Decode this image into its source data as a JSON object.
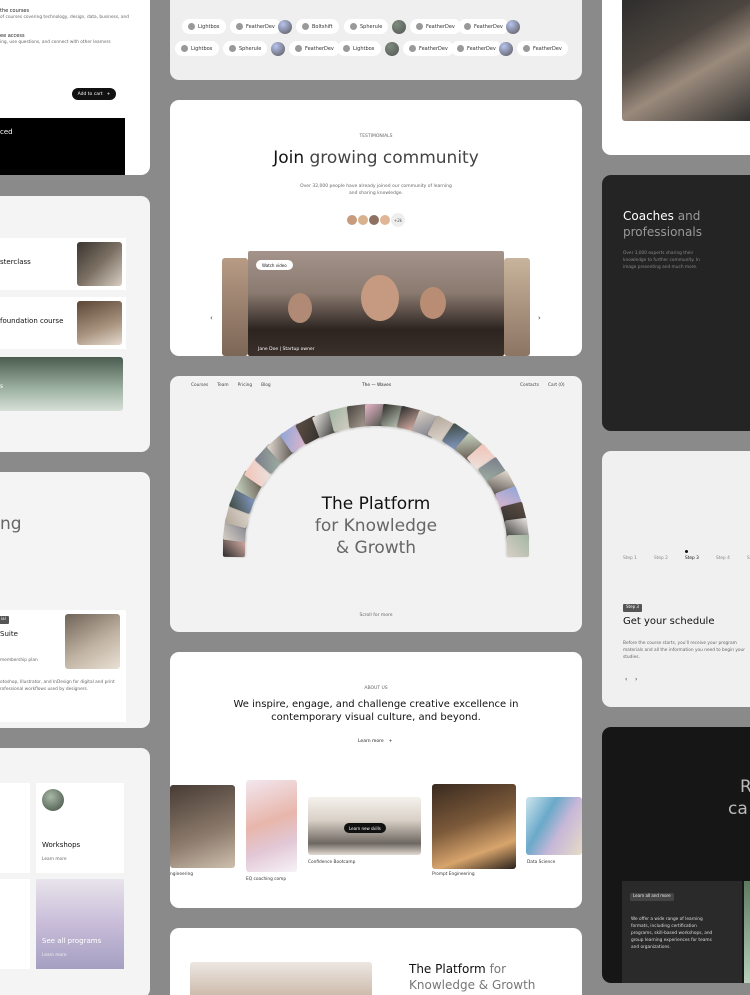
{
  "colors": {
    "page_bg": "#8a8a8a",
    "card_light": "#f4f4f4",
    "card_dark": "#1f1f1f"
  },
  "left": {
    "card1": {
      "line1": "the courses",
      "line2": "of courses covering technology, design, data, business, and",
      "line3": "ee access",
      "line4": "ing, use questions, and connect with other learners",
      "add_to_cart": "Add to cart",
      "add_to_cart_icon": "+",
      "dark_title": "ced"
    },
    "card2": {
      "item1": "sterclass",
      "item2": "foundation course",
      "banner_label": "s"
    },
    "card3": {
      "heading": "ng",
      "tag": "ial",
      "suite": "Suite",
      "plan": "membership plan",
      "desc1": "otoshop, Illustrator, and InDesign for digital and print",
      "desc2": "rofessional workflows used by designers."
    },
    "card4": {
      "workshops": "Workshops",
      "learn_more": "Learn more",
      "see_all": "See all programs",
      "see_all_sub": "Learn more"
    }
  },
  "center": {
    "logos_row1": [
      {
        "name": "Lightbox",
        "icon": "circle-logo-icon"
      },
      {
        "name": "FeatherDev",
        "icon": "feather-logo-icon"
      },
      {
        "name": "Boltshift",
        "icon": "bolt-logo-icon"
      },
      {
        "name": "Spherule",
        "icon": "sphere-logo-icon"
      },
      {
        "name": "FeatherDev",
        "icon": "feather-logo-icon"
      },
      {
        "name": "FeatherDev",
        "icon": "feather-logo-icon"
      }
    ],
    "logos_row2": [
      {
        "name": "Lightbox",
        "icon": "circle-logo-icon"
      },
      {
        "name": "Spherule",
        "icon": "sphere-logo-icon"
      },
      {
        "name": "FeatherDev",
        "icon": "feather-logo-icon"
      },
      {
        "name": "Lightbox",
        "icon": "circle-logo-icon"
      },
      {
        "name": "FeatherDev",
        "icon": "feather-logo-icon"
      },
      {
        "name": "FeatherDev",
        "icon": "feather-logo-icon"
      },
      {
        "name": "FeatherDev",
        "icon": "feather-logo-icon"
      }
    ],
    "testimonials": {
      "eyebrow": "TESTIMONIALS",
      "title_a": "Join",
      "title_b": "growing community",
      "sub1": "Over 32,000 people have already joined our community of learning",
      "sub2": "and sharing knowledge.",
      "count_badge": "+2k",
      "watch": "Watch video",
      "person": "Jane Doe",
      "role": "Startup owner",
      "prev": "‹",
      "next": "›"
    },
    "hero": {
      "nav": [
        "Courses",
        "Team",
        "Pricing",
        "Blog"
      ],
      "brand": "The — Waves",
      "nav_right": [
        "Contacts",
        "Cart (0)"
      ],
      "title1": "The Platform",
      "title2": "for Knowledge",
      "title3": "& Growth",
      "scroll": "Scroll for more"
    },
    "about": {
      "eyebrow": "ABOUT US",
      "line1": "We inspire, engage, and challenge creative excellence in",
      "line2": "contemporary visual culture, and beyond.",
      "learn": "Learn more",
      "learn_icon": "+",
      "cards": [
        "ngineering",
        "EQ coaching comp",
        "Confidence Bootcamp",
        "Prompt Engineering",
        "Data Science"
      ],
      "learn_pill": "Learn new skills"
    },
    "bottom": {
      "title_a": "The Platform",
      "title_b": "for",
      "title_c": "Knowledge & Growth"
    }
  },
  "right": {
    "coaches": {
      "title_a": "Coaches",
      "title_b": "and",
      "title_c": "professionals",
      "desc1": "Over 3,000 experts sharing their",
      "desc2": "knowledge to further community. In",
      "desc3": "image presenting and much more."
    },
    "schedule": {
      "steps": [
        "Step 1",
        "Step 2",
        "Step 3",
        "Step 4",
        "Ste"
      ],
      "tag": "Step 3",
      "title": "Get your schedule",
      "desc1": "Before the course starts, you'll receive your program",
      "desc2": "materials and all the information you need to begin your",
      "desc3": "studies.",
      "prev": "‹",
      "next": "›"
    },
    "last": {
      "big1": "R",
      "big2": "ca",
      "tag": "Learn all and more",
      "p1": "We offer a wide range of learning",
      "p2": "formats, including certification",
      "p3": "programs, skill-based workshops, and",
      "p4": "group learning experiences for teams",
      "p5": "and organizations."
    }
  }
}
